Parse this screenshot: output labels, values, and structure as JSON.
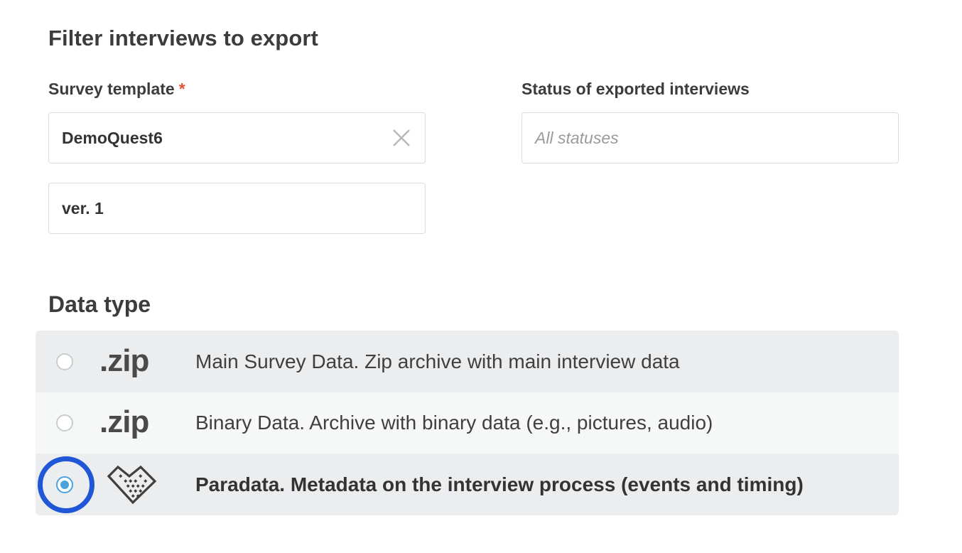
{
  "filter": {
    "title": "Filter interviews to export",
    "survey_template_label": "Survey template",
    "required_mark": "*",
    "survey_template_value": "DemoQuest6",
    "version_value": "ver. 1",
    "status_label": "Status of exported interviews",
    "status_placeholder": "All statuses"
  },
  "data_type": {
    "title": "Data type",
    "options": [
      {
        "ext": ".zip",
        "label": "Main Survey Data. Zip archive with main interview data",
        "selected": false
      },
      {
        "ext": ".zip",
        "label": "Binary Data. Archive with binary data (e.g., pictures, audio)",
        "selected": false
      },
      {
        "icon": "paradata-icon",
        "label": "Paradata. Metadata on the interview process (events and timing)",
        "selected": true
      }
    ]
  },
  "colors": {
    "accent": "#4aa3df",
    "focus_ring": "#1f57d6",
    "required": "#e2523a"
  }
}
